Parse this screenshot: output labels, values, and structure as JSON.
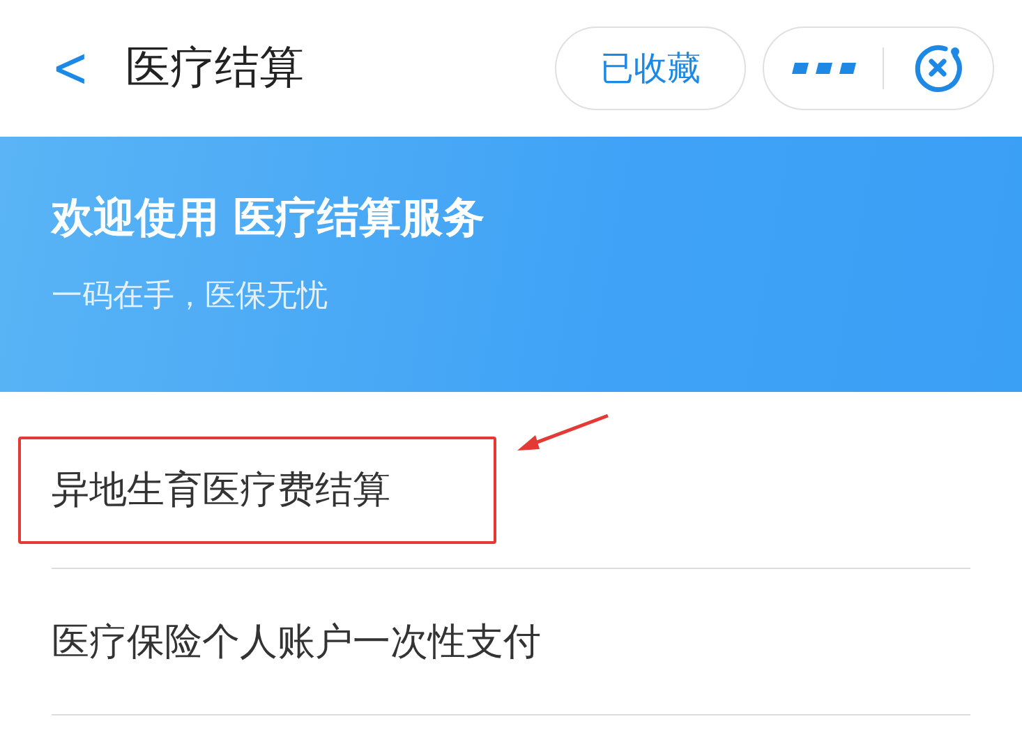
{
  "header": {
    "back": "<",
    "title": "医疗结算",
    "favorite_button": "已收藏"
  },
  "banner": {
    "title": "欢迎使用 医疗结算服务",
    "subtitle": "一码在手，医保无忧"
  },
  "items": [
    {
      "label": "异地生育医疗费结算",
      "highlighted": true
    },
    {
      "label": "医疗保险个人账户一次性支付",
      "highlighted": false
    }
  ]
}
